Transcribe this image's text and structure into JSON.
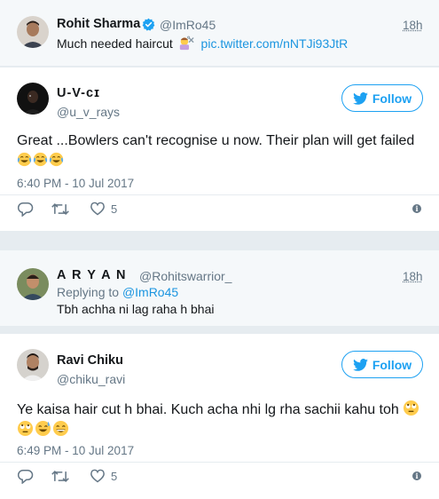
{
  "context_tweet": {
    "name": "Rohit Sharma",
    "handle": "@ImRo45",
    "time": "18h",
    "text": "Much needed haircut",
    "link": "pic.twitter.com/nNTJi93JtR",
    "verified_icon": "verified-badge-icon",
    "emoji": "haircut-emoji"
  },
  "reply1": {
    "name": "U-V-ᴄɪ",
    "handle": "@u_v_rays",
    "follow_label": "Follow",
    "text": "Great ...Bowlers can't recognise u now. Their plan will get failed",
    "emojis": [
      "joy-emoji",
      "joy-emoji",
      "joy-emoji"
    ],
    "timestamp": "6:40 PM - 10 Jul 2017",
    "likes": "5"
  },
  "context_reply": {
    "name": "A R Y A N",
    "handle": "@Rohitswarrior_",
    "time": "18h",
    "replying_to_label": "Replying to",
    "replying_to_handle": "@ImRo45",
    "text": "Tbh achha ni lag raha h bhai"
  },
  "reply2": {
    "name": "Ravi Chiku",
    "handle": "@chiku_ravi",
    "follow_label": "Follow",
    "text": "Ye kaisa hair cut h bhai. Kuch acha nhi lg rha sachii kahu toh",
    "emojis": [
      "eye-roll-emoji",
      "eye-roll-emoji",
      "sweat-smile-emoji",
      "grin-emoji"
    ],
    "timestamp": "6:49 PM - 10 Jul 2017",
    "likes": "5"
  },
  "colors": {
    "accent": "#1da1f2",
    "link": "#1b95e0",
    "muted": "#657786",
    "background": "#e6ecf0"
  }
}
